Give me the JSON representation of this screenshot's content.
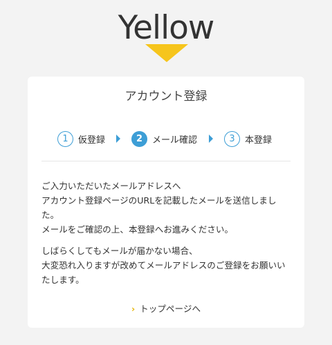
{
  "brand": {
    "logo_text": "Yellow",
    "accent_color": "#f6c51c"
  },
  "card": {
    "title": "アカウント登録",
    "steps": [
      {
        "number": "1",
        "label": "仮登録",
        "active": false
      },
      {
        "number": "2",
        "label": "メール確認",
        "active": true
      },
      {
        "number": "3",
        "label": "本登録",
        "active": false
      }
    ],
    "step_color": "#3d9ed6",
    "paragraphs": [
      [
        "ご入力いただいたメールアドレスへ",
        "アカウント登録ページのURLを記載したメールを送信しました。",
        "メールをご確認の上、本登録へお進みください。"
      ],
      [
        "しばらくしてもメールが届かない場合、",
        "大変恐れ入りますが改めてメールアドレスのご登録をお願いいたします。"
      ]
    ],
    "top_link_label": "トップページへ"
  }
}
